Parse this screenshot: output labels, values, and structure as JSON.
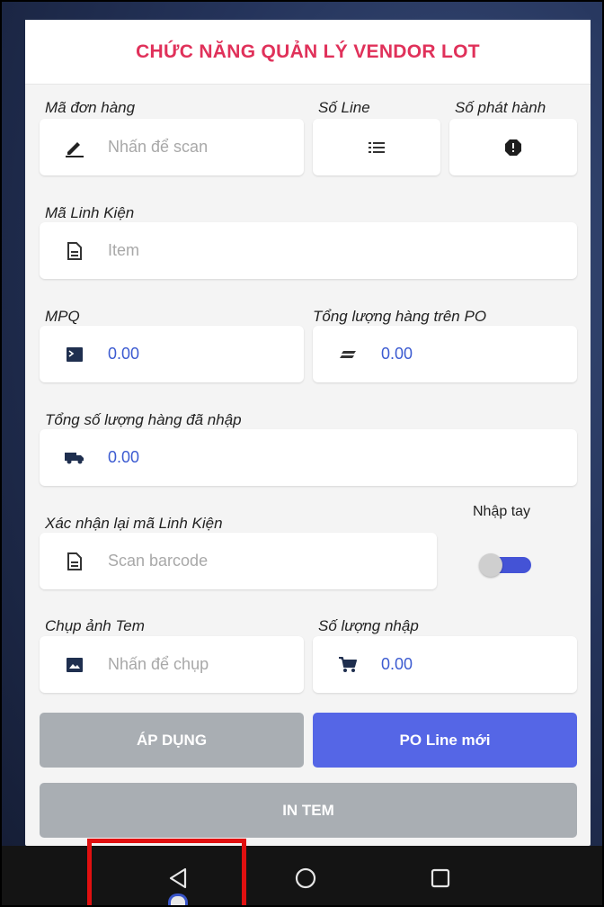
{
  "header": {
    "title": "CHỨC NĂNG QUẢN LÝ VENDOR LOT"
  },
  "order": {
    "label": "Mã đơn hàng",
    "placeholder": "Nhấn để scan",
    "icon": "pencil-icon"
  },
  "line": {
    "label": "Số Line",
    "icon": "list-icon"
  },
  "release": {
    "label": "Số phát hành",
    "icon": "alert-circle-icon"
  },
  "part_code": {
    "label": "Mã Linh Kiện",
    "placeholder": "Item",
    "icon": "document-icon"
  },
  "mpq": {
    "label": "MPQ",
    "value": "0.00",
    "icon": "terminal-icon"
  },
  "po_total": {
    "label": "Tổng lượng hàng trên PO",
    "value": "0.00",
    "icon": "equals-icon"
  },
  "received_total": {
    "label": "Tổng số lượng hàng đã nhập",
    "value": "0.00",
    "icon": "truck-icon"
  },
  "confirm_part": {
    "label": "Xác nhận lại mã Linh Kiện",
    "placeholder": "Scan barcode",
    "icon": "document-icon"
  },
  "manual_input": {
    "label": "Nhập tay",
    "enabled": true
  },
  "photo": {
    "label": "Chụp ảnh Tem",
    "placeholder": "Nhấn để chụp",
    "icon": "image-icon"
  },
  "quantity": {
    "label": "Số lượng nhập",
    "value": "0.00",
    "icon": "cart-icon"
  },
  "buttons": {
    "apply": "ÁP DỤNG",
    "new_po_line": "PO Line mới",
    "print": "IN TEM"
  },
  "navbar": {
    "back_icon": "back-triangle-icon",
    "home_icon": "home-circle-icon",
    "recents_icon": "recents-square-icon"
  },
  "colors": {
    "accent_title": "#e0315a",
    "value_blue": "#3c5bd1",
    "button_blue": "#5566e6",
    "button_gray": "#a9aeb3",
    "highlight_red": "#e01010"
  }
}
